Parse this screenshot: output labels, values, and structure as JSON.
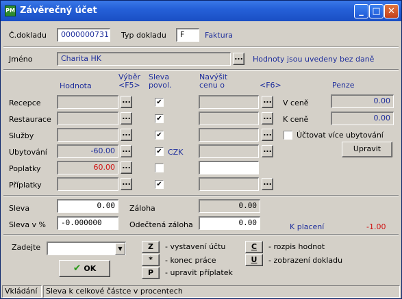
{
  "window": {
    "title": "Závěrečný účet",
    "app_icon_text": "PM",
    "minimize": "_",
    "maximize": "□",
    "close": "✕"
  },
  "top": {
    "cdokladu_label": "Č.dokladu",
    "cdokladu_value": "0000000731",
    "typ_label": "Typ dokladu",
    "typ_value": "F",
    "typ_name": "Faktura"
  },
  "jmeno": {
    "label": "Jméno",
    "value": "Charita HK",
    "note": "Hodnoty jsou uvedeny bez daně"
  },
  "headers": {
    "hodnota": "Hodnota",
    "vyber_1": "Výběr",
    "vyber_2": "<F5>",
    "sleva_1": "Sleva",
    "sleva_2": "povol.",
    "navysit_1": "Navýšit",
    "navysit_2": "cenu o",
    "f6": "<F6>",
    "penze": "Penze"
  },
  "dots_label": "...",
  "rows": [
    {
      "label": "Recepce",
      "value": "",
      "checked": "✔",
      "navyseni": ""
    },
    {
      "label": "Restaurace",
      "value": "",
      "checked": "✔",
      "navyseni": ""
    },
    {
      "label": "Služby",
      "value": "",
      "checked": "✔",
      "navyseni": ""
    },
    {
      "label": "Ubytování",
      "value": "-60.00",
      "checked": "✔",
      "navyseni": "",
      "currency": "CZK"
    },
    {
      "label": "Poplatky",
      "value": "60.00",
      "checked": "",
      "navyseni": ""
    },
    {
      "label": "Příplatky",
      "value": "",
      "checked": "✔",
      "navyseni": ""
    }
  ],
  "penze": {
    "v_cene_label": "V ceně",
    "v_cene_value": "0.00",
    "k_cene_label": "K ceně",
    "k_cene_value": "0.00",
    "uctovat_label": "Účtovat více ubytování",
    "uctovat_checked": "",
    "upravit_label": "Upravit"
  },
  "totals": {
    "sleva_label": "Sleva",
    "sleva_value": "0.00",
    "sleva_pct_label": "Sleva v %",
    "sleva_pct_value": "-0.000000",
    "zaloha_label": "Záloha",
    "zaloha_value": "0.00",
    "odectena_label": "Odečtená záloha",
    "odectena_value": "0.00",
    "k_placeni_label": "K placení",
    "k_placeni_value": "-1.00"
  },
  "bottom": {
    "zadejte_label": "Zadejte",
    "zadejte_value": "",
    "ok_label": "OK",
    "z_key": "Z",
    "z_text": "- vystavení účtu",
    "star_key": "*",
    "star_text": "- konec práce",
    "p_key": "P",
    "p_text": "- upravit příplatek",
    "c_key": "C",
    "c_text": "- rozpis hodnot",
    "u_key": "U",
    "u_text": "- zobrazení dokladu"
  },
  "status": {
    "mode": "Vkládání",
    "hint": "Sleva k celkové částce v procentech"
  },
  "colors": {
    "accent_blue": "#1e2e9c",
    "negative_red": "#d01010",
    "title_blue": "#2560d8"
  }
}
